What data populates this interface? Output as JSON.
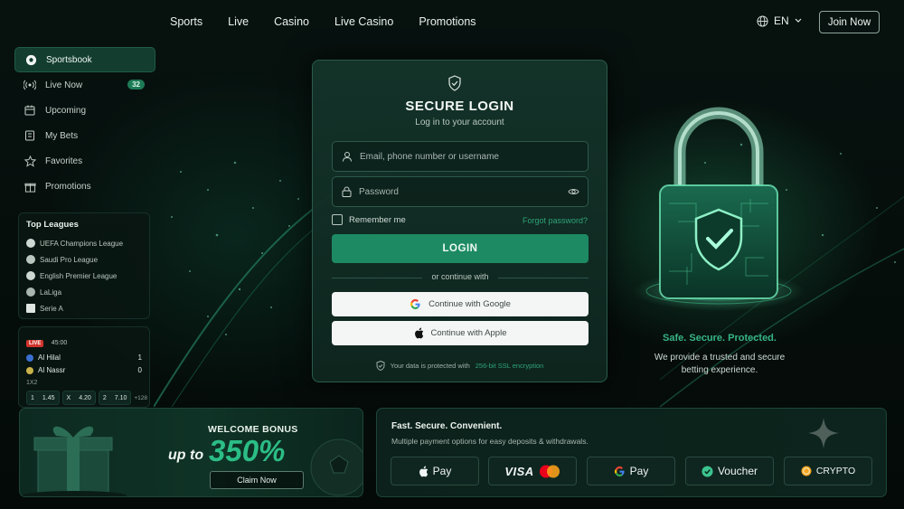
{
  "nav": {
    "links": [
      "Sports",
      "Live",
      "Casino",
      "Live Casino",
      "Promotions"
    ],
    "language": "EN",
    "join_label": "Join Now"
  },
  "sidebar": {
    "items": [
      {
        "label": "Sportsbook",
        "icon": "soccer-ball-icon",
        "active": true
      },
      {
        "label": "Live Now",
        "icon": "broadcast-icon",
        "badge": "32"
      },
      {
        "label": "Upcoming",
        "icon": "calendar-icon"
      },
      {
        "label": "My Bets",
        "icon": "ticket-icon"
      },
      {
        "label": "Favorites",
        "icon": "star-icon"
      },
      {
        "label": "Promotions",
        "icon": "gift-icon"
      }
    ]
  },
  "leagues": {
    "title": "Top Leagues",
    "items": [
      "UEFA Champions League",
      "Saudi Pro League",
      "English Premier League",
      "LaLiga",
      "Serie A"
    ]
  },
  "match": {
    "live_label": "LIVE",
    "time": "45:00",
    "home": {
      "name": "Al Hilal",
      "score": "1"
    },
    "away": {
      "name": "Al Nassr",
      "score": "0"
    },
    "market": "1X2",
    "odds": [
      {
        "label": "1",
        "value": "1.45"
      },
      {
        "label": "X",
        "value": "4.20"
      },
      {
        "label": "2",
        "value": "7.10"
      }
    ],
    "more": "+128"
  },
  "login": {
    "title": "SECURE LOGIN",
    "subtitle": "Log in to your account",
    "username_placeholder": "Email, phone number or username",
    "password_placeholder": "Password",
    "remember_label": "Remember me",
    "forgot_label": "Forgot password?",
    "login_label": "LOGIN",
    "divider_text": "or continue with",
    "google_label": "Continue with Google",
    "apple_label": "Continue with Apple",
    "note_prefix": "Your data is protected with",
    "note_highlight": "256-bit SSL encryption"
  },
  "promo": {
    "tagline": "Safe. Secure. Protected.",
    "description": "We provide a trusted and secure betting experience."
  },
  "bonus": {
    "heading": "WELCOME BONUS",
    "up_to": "up to",
    "amount": "350%",
    "claim_label": "Claim Now"
  },
  "payments": {
    "title": "Fast. Secure. Convenient.",
    "subtitle": "Multiple payment options for easy deposits & withdrawals.",
    "methods": [
      "Pay",
      "VISA",
      "Pay",
      "Voucher",
      "CRYPTO"
    ]
  },
  "colors": {
    "accent": "#1d8a63",
    "accent_text": "#2fa37a",
    "background": "#050d0b",
    "live": "#d0342c"
  }
}
